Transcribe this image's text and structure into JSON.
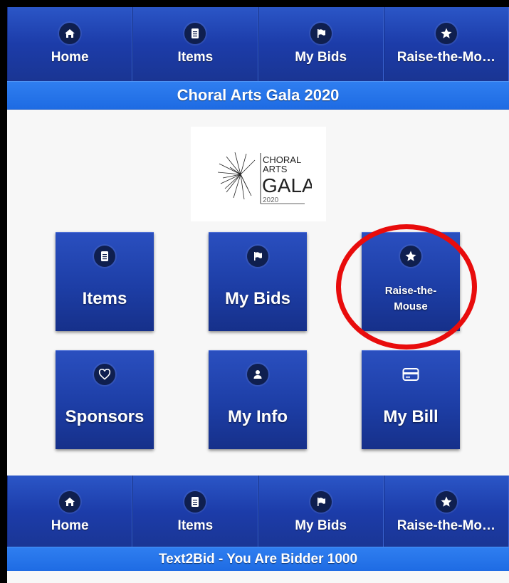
{
  "top_nav": [
    {
      "label": "Home",
      "icon": "home-icon"
    },
    {
      "label": "Items",
      "icon": "document-icon"
    },
    {
      "label": "My Bids",
      "icon": "flag-icon"
    },
    {
      "label": "Raise-the-Mo…",
      "icon": "star-icon"
    }
  ],
  "header_title": "Choral Arts Gala 2020",
  "logo": {
    "line1": "CHORAL",
    "line2": "ARTS",
    "line3": "GALA",
    "year": "2020"
  },
  "tiles": [
    {
      "label": "Items",
      "icon": "document-icon"
    },
    {
      "label": "My Bids",
      "icon": "flag-icon"
    },
    {
      "label_line1": "Raise-the-",
      "label_line2": "Mouse",
      "icon": "star-icon"
    },
    {
      "label": "Sponsors",
      "icon": "heart-icon"
    },
    {
      "label": "My Info",
      "icon": "person-icon"
    },
    {
      "label": "My Bill",
      "icon": "credit-card-icon"
    }
  ],
  "bottom_nav": [
    {
      "label": "Home",
      "icon": "home-icon"
    },
    {
      "label": "Items",
      "icon": "document-icon"
    },
    {
      "label": "My Bids",
      "icon": "flag-icon"
    },
    {
      "label": "Raise-the-Mo…",
      "icon": "star-icon"
    }
  ],
  "footer_title": "Text2Bid - You Are Bidder 1000",
  "colors": {
    "nav_blue": "#1c3ca9",
    "title_blue": "#2470e8",
    "highlight_red": "#e80c0c"
  }
}
